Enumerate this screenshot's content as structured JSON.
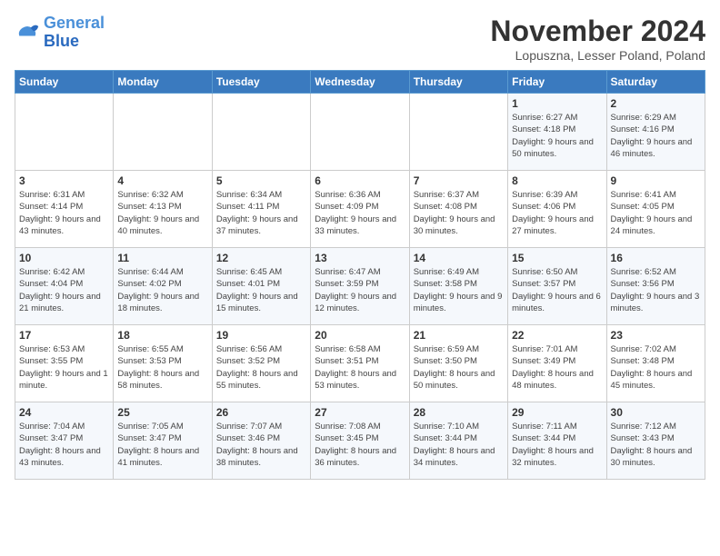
{
  "header": {
    "logo_line1": "General",
    "logo_line2": "Blue",
    "month_title": "November 2024",
    "location": "Lopuszna, Lesser Poland, Poland"
  },
  "days_of_week": [
    "Sunday",
    "Monday",
    "Tuesday",
    "Wednesday",
    "Thursday",
    "Friday",
    "Saturday"
  ],
  "weeks": [
    [
      {
        "day": "",
        "info": ""
      },
      {
        "day": "",
        "info": ""
      },
      {
        "day": "",
        "info": ""
      },
      {
        "day": "",
        "info": ""
      },
      {
        "day": "",
        "info": ""
      },
      {
        "day": "1",
        "info": "Sunrise: 6:27 AM\nSunset: 4:18 PM\nDaylight: 9 hours and 50 minutes."
      },
      {
        "day": "2",
        "info": "Sunrise: 6:29 AM\nSunset: 4:16 PM\nDaylight: 9 hours and 46 minutes."
      }
    ],
    [
      {
        "day": "3",
        "info": "Sunrise: 6:31 AM\nSunset: 4:14 PM\nDaylight: 9 hours and 43 minutes."
      },
      {
        "day": "4",
        "info": "Sunrise: 6:32 AM\nSunset: 4:13 PM\nDaylight: 9 hours and 40 minutes."
      },
      {
        "day": "5",
        "info": "Sunrise: 6:34 AM\nSunset: 4:11 PM\nDaylight: 9 hours and 37 minutes."
      },
      {
        "day": "6",
        "info": "Sunrise: 6:36 AM\nSunset: 4:09 PM\nDaylight: 9 hours and 33 minutes."
      },
      {
        "day": "7",
        "info": "Sunrise: 6:37 AM\nSunset: 4:08 PM\nDaylight: 9 hours and 30 minutes."
      },
      {
        "day": "8",
        "info": "Sunrise: 6:39 AM\nSunset: 4:06 PM\nDaylight: 9 hours and 27 minutes."
      },
      {
        "day": "9",
        "info": "Sunrise: 6:41 AM\nSunset: 4:05 PM\nDaylight: 9 hours and 24 minutes."
      }
    ],
    [
      {
        "day": "10",
        "info": "Sunrise: 6:42 AM\nSunset: 4:04 PM\nDaylight: 9 hours and 21 minutes."
      },
      {
        "day": "11",
        "info": "Sunrise: 6:44 AM\nSunset: 4:02 PM\nDaylight: 9 hours and 18 minutes."
      },
      {
        "day": "12",
        "info": "Sunrise: 6:45 AM\nSunset: 4:01 PM\nDaylight: 9 hours and 15 minutes."
      },
      {
        "day": "13",
        "info": "Sunrise: 6:47 AM\nSunset: 3:59 PM\nDaylight: 9 hours and 12 minutes."
      },
      {
        "day": "14",
        "info": "Sunrise: 6:49 AM\nSunset: 3:58 PM\nDaylight: 9 hours and 9 minutes."
      },
      {
        "day": "15",
        "info": "Sunrise: 6:50 AM\nSunset: 3:57 PM\nDaylight: 9 hours and 6 minutes."
      },
      {
        "day": "16",
        "info": "Sunrise: 6:52 AM\nSunset: 3:56 PM\nDaylight: 9 hours and 3 minutes."
      }
    ],
    [
      {
        "day": "17",
        "info": "Sunrise: 6:53 AM\nSunset: 3:55 PM\nDaylight: 9 hours and 1 minute."
      },
      {
        "day": "18",
        "info": "Sunrise: 6:55 AM\nSunset: 3:53 PM\nDaylight: 8 hours and 58 minutes."
      },
      {
        "day": "19",
        "info": "Sunrise: 6:56 AM\nSunset: 3:52 PM\nDaylight: 8 hours and 55 minutes."
      },
      {
        "day": "20",
        "info": "Sunrise: 6:58 AM\nSunset: 3:51 PM\nDaylight: 8 hours and 53 minutes."
      },
      {
        "day": "21",
        "info": "Sunrise: 6:59 AM\nSunset: 3:50 PM\nDaylight: 8 hours and 50 minutes."
      },
      {
        "day": "22",
        "info": "Sunrise: 7:01 AM\nSunset: 3:49 PM\nDaylight: 8 hours and 48 minutes."
      },
      {
        "day": "23",
        "info": "Sunrise: 7:02 AM\nSunset: 3:48 PM\nDaylight: 8 hours and 45 minutes."
      }
    ],
    [
      {
        "day": "24",
        "info": "Sunrise: 7:04 AM\nSunset: 3:47 PM\nDaylight: 8 hours and 43 minutes."
      },
      {
        "day": "25",
        "info": "Sunrise: 7:05 AM\nSunset: 3:47 PM\nDaylight: 8 hours and 41 minutes."
      },
      {
        "day": "26",
        "info": "Sunrise: 7:07 AM\nSunset: 3:46 PM\nDaylight: 8 hours and 38 minutes."
      },
      {
        "day": "27",
        "info": "Sunrise: 7:08 AM\nSunset: 3:45 PM\nDaylight: 8 hours and 36 minutes."
      },
      {
        "day": "28",
        "info": "Sunrise: 7:10 AM\nSunset: 3:44 PM\nDaylight: 8 hours and 34 minutes."
      },
      {
        "day": "29",
        "info": "Sunrise: 7:11 AM\nSunset: 3:44 PM\nDaylight: 8 hours and 32 minutes."
      },
      {
        "day": "30",
        "info": "Sunrise: 7:12 AM\nSunset: 3:43 PM\nDaylight: 8 hours and 30 minutes."
      }
    ]
  ]
}
